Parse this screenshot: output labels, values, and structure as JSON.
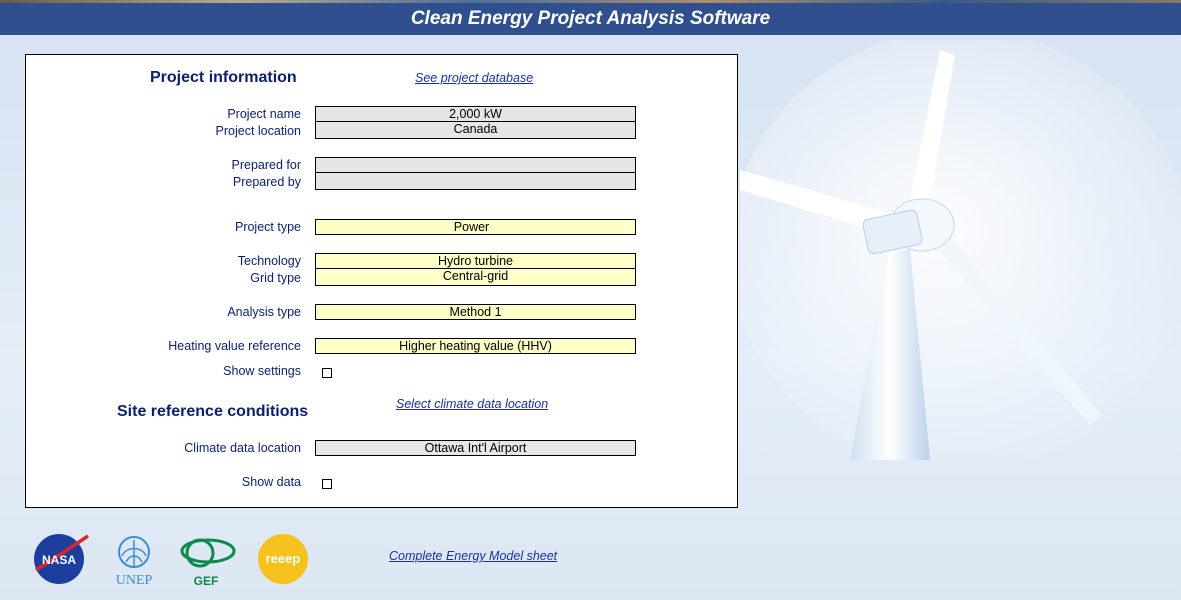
{
  "app_title": "Clean Energy Project Analysis Software",
  "project_info": {
    "title": "Project information",
    "db_link": "See project database",
    "project_name_label": "Project name",
    "project_name": "2,000 kW",
    "project_location_label": "Project location",
    "project_location": "Canada",
    "prepared_for_label": "Prepared for",
    "prepared_for": "",
    "prepared_by_label": "Prepared by",
    "prepared_by": "",
    "project_type_label": "Project type",
    "project_type": "Power",
    "technology_label": "Technology",
    "technology": "Hydro turbine",
    "grid_type_label": "Grid type",
    "grid_type": "Central-grid",
    "analysis_type_label": "Analysis type",
    "analysis_type": "Method 1",
    "heating_value_label": "Heating value reference",
    "heating_value": "Higher heating value (HHV)",
    "show_settings_label": "Show settings"
  },
  "site": {
    "title": "Site reference conditions",
    "climate_link": "Select climate data location",
    "climate_label": "Climate data location",
    "climate_value": "Ottawa Int'l Airport",
    "show_data_label": "Show data"
  },
  "footer": {
    "energy_model_link": "Complete Energy Model sheet",
    "logos": {
      "nasa": "NASA",
      "unep": "UNEP",
      "gef": "GEF",
      "reeep": "reeep"
    }
  },
  "colors": {
    "title_bar": "#2f4f8e",
    "input_yellow": "#ffffc8",
    "input_grey": "#e6e6e6",
    "label_text": "#0a1f6e",
    "link": "#1a2fa0"
  }
}
